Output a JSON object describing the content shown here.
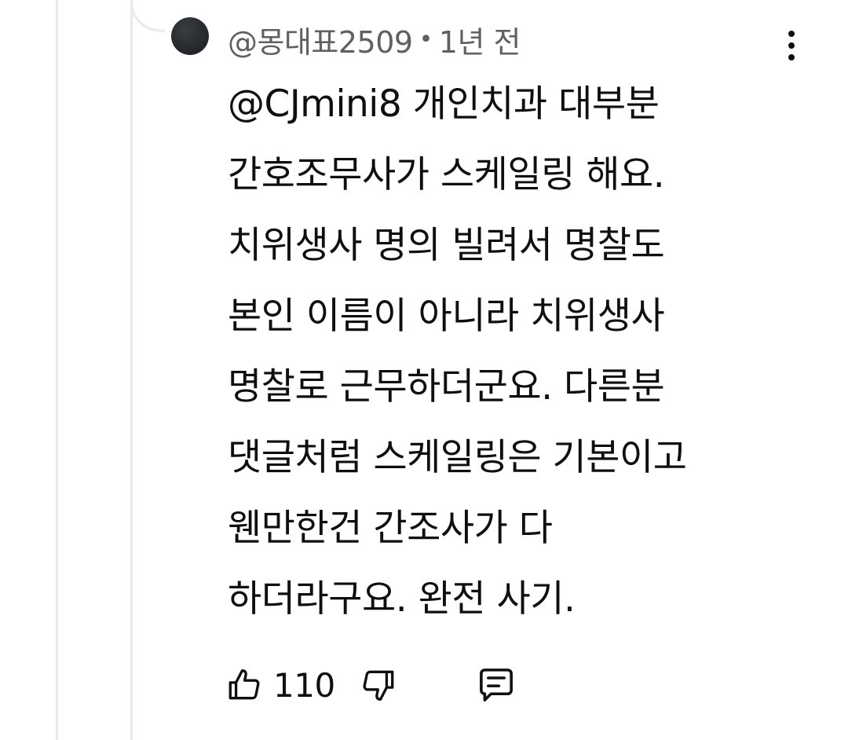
{
  "comment": {
    "author": "@몽대표2509",
    "separator": "•",
    "time": "1년 전",
    "text_lines": [
      "@CJmini8 개인치과 대부분",
      "간호조무사가 스케일링 해요.",
      "치위생사 명의 빌려서 명찰도",
      "본인 이름이 아니라 치위생사",
      "명찰로 근무하더군요. 다른분",
      "댓글처럼 스케일링은 기본이고",
      "웬만한건 간조사가 다",
      "하더라구요. 완전 사기."
    ],
    "like_count": "110"
  },
  "icons": {
    "like": "thumbs-up-icon",
    "dislike": "thumbs-down-icon",
    "reply": "comment-reply-icon",
    "more": "more-vertical-icon"
  },
  "colors": {
    "text": "#0f0f0f",
    "meta": "#606060",
    "thread_line": "#e9e9e9"
  }
}
